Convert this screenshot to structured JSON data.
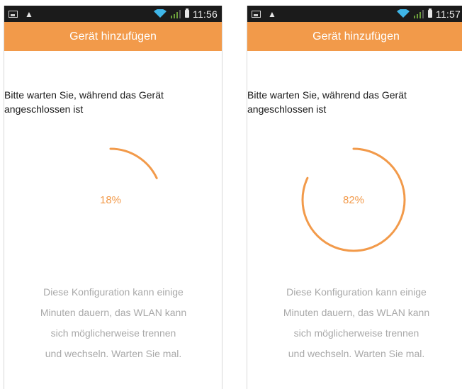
{
  "screens": [
    {
      "time": "11:56",
      "title": "Gerät hinzufügen",
      "message": "Bitte warten Sie, während das Gerät angeschlossen ist",
      "progress_label": "18%",
      "progress": 0.18,
      "info_lines": [
        "Diese Konfiguration kann einige",
        "Minuten dauern, das WLAN kann",
        "sich möglicherweise trennen",
        "und wechseln. Warten Sie mal."
      ]
    },
    {
      "time": "11:57",
      "title": "Gerät hinzufügen",
      "message": "Bitte warten Sie, während das Gerät angeschlossen ist",
      "progress_label": "82%",
      "progress": 0.82,
      "info_lines": [
        "Diese Konfiguration kann einige",
        "Minuten dauern, das WLAN kann",
        "sich möglicherweise trennen",
        "und wechseln. Warten Sie mal."
      ]
    }
  ],
  "colors": {
    "accent": "#f29a4a",
    "statusbar": "#1b1b1b",
    "wifi": "#3fb6e8",
    "info_text": "#a9a9a9"
  },
  "icons": [
    "image-icon",
    "warning-icon",
    "wifi-icon",
    "signal-icon",
    "battery-icon"
  ]
}
